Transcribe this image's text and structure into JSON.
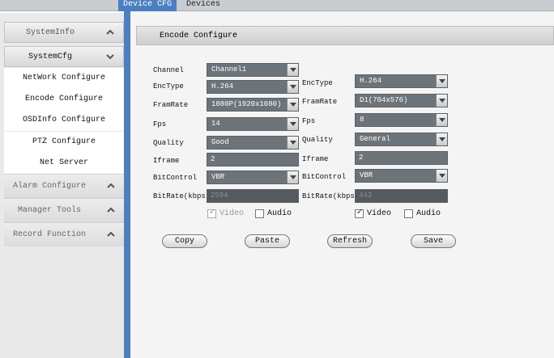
{
  "tabs": {
    "device_cfg": "Device CFG",
    "devices": "Devices"
  },
  "sidebar": {
    "system_info": "SystemInfo",
    "system_cfg": "SystemCfg",
    "items": [
      "NetWork Configure",
      "Encode Configure",
      "OSDInfo Configure",
      "PTZ Configure",
      "Net Server"
    ],
    "alarm": "Alarm Configure",
    "manager": "Manager Tools",
    "record": "Record Function"
  },
  "panel": {
    "title": "Encode Configure"
  },
  "labels": {
    "channel": "Channel",
    "enctype": "EncType",
    "framrate": "FramRate",
    "fps": "Fps",
    "quality": "Quality",
    "iframe": "Iframe",
    "bitcontrol": "BitControl",
    "bitrate": "BitRate(kbps)",
    "video": "Video",
    "audio": "Audio"
  },
  "main_stream": {
    "channel": "Channel1",
    "enctype": "H.264",
    "framrate": "1080P(1920x1080)",
    "fps": "14",
    "quality": "Good",
    "iframe": "2",
    "bitcontrol": "VBR",
    "bitrate": "2594",
    "video_checked": true,
    "audio_checked": false
  },
  "extra_stream": {
    "enctype": "H.264",
    "framrate": "D1(704x576)",
    "fps": "8",
    "quality": "General",
    "iframe": "2",
    "bitcontrol": "VBR",
    "bitrate": "443",
    "video_checked": true,
    "audio_checked": false
  },
  "buttons": {
    "copy": "Copy",
    "paste": "Paste",
    "refresh": "Refresh",
    "save": "Save"
  }
}
